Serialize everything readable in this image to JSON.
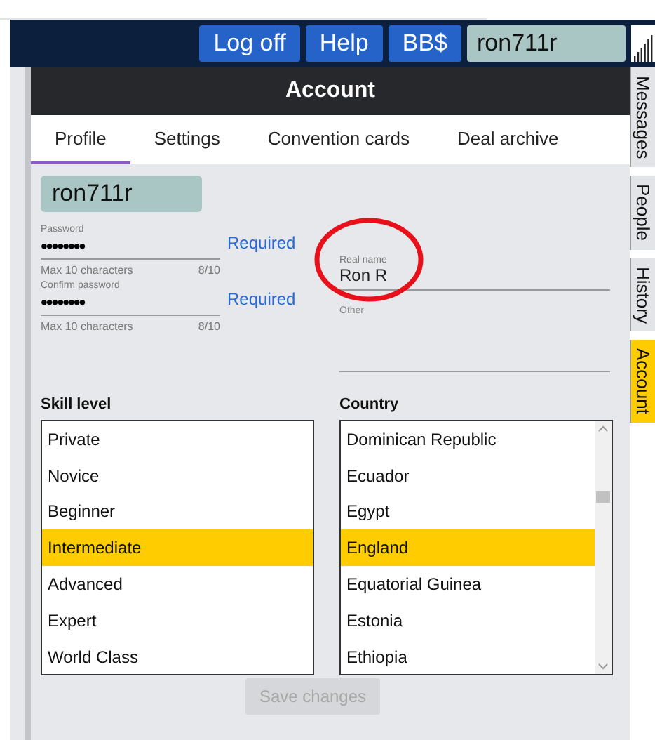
{
  "topbar": {
    "buttons": [
      "Log off",
      "Help",
      "BB$"
    ],
    "username": "ron711r"
  },
  "panel": {
    "title": "Account"
  },
  "tabs": [
    {
      "label": "Profile",
      "selected": true
    },
    {
      "label": "Settings",
      "selected": false
    },
    {
      "label": "Convention cards",
      "selected": false
    },
    {
      "label": "Deal archive",
      "selected": false
    }
  ],
  "side_tabs": [
    {
      "label": "Messages",
      "selected": false
    },
    {
      "label": "People",
      "selected": false
    },
    {
      "label": "History",
      "selected": false
    },
    {
      "label": "Account",
      "selected": true
    }
  ],
  "profile": {
    "username": "ron711r",
    "passwords": [
      {
        "label": "Password",
        "value": "••••••••",
        "hint": "Max 10 characters",
        "count": "8/10",
        "status": "Required"
      },
      {
        "label": "Confirm password",
        "value": "••••••••",
        "hint": "Max 10 characters",
        "count": "8/10",
        "status": "Required"
      }
    ],
    "real_name": {
      "label": "Real name",
      "value": "Ron R"
    },
    "other": {
      "label": "Other"
    }
  },
  "skill_level": {
    "title": "Skill level",
    "items": [
      {
        "label": "Private",
        "selected": false
      },
      {
        "label": "Novice",
        "selected": false
      },
      {
        "label": "Beginner",
        "selected": false
      },
      {
        "label": "Intermediate",
        "selected": true
      },
      {
        "label": "Advanced",
        "selected": false
      },
      {
        "label": "Expert",
        "selected": false
      },
      {
        "label": "World Class",
        "selected": false
      }
    ]
  },
  "country": {
    "title": "Country",
    "items": [
      {
        "label": "Dominican Republic",
        "selected": false
      },
      {
        "label": "Ecuador",
        "selected": false
      },
      {
        "label": "Egypt",
        "selected": false
      },
      {
        "label": "England",
        "selected": true
      },
      {
        "label": "Equatorial Guinea",
        "selected": false
      },
      {
        "label": "Estonia",
        "selected": false
      },
      {
        "label": "Ethiopia",
        "selected": false
      }
    ]
  },
  "save_button": {
    "label": "Save changes",
    "disabled": true
  }
}
